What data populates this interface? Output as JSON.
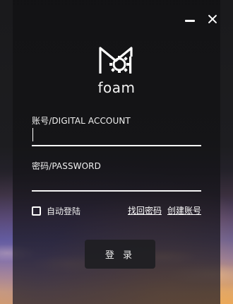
{
  "window": {
    "controls": {
      "minimize_icon": "minimize-icon",
      "close_icon": "close-icon"
    }
  },
  "brand": {
    "name": "foam",
    "logo_icon": "foam-logo-icon",
    "accent": "#ffffff"
  },
  "account": {
    "label": "账号/DIGITAL ACCOUNT",
    "value": ""
  },
  "password": {
    "label": "密码/PASSWORD",
    "value": ""
  },
  "remember": {
    "label": "自动登陆",
    "checked": false
  },
  "links": {
    "forgot": "找回密码",
    "register": "创建账号"
  },
  "login": {
    "label": "登 录"
  }
}
